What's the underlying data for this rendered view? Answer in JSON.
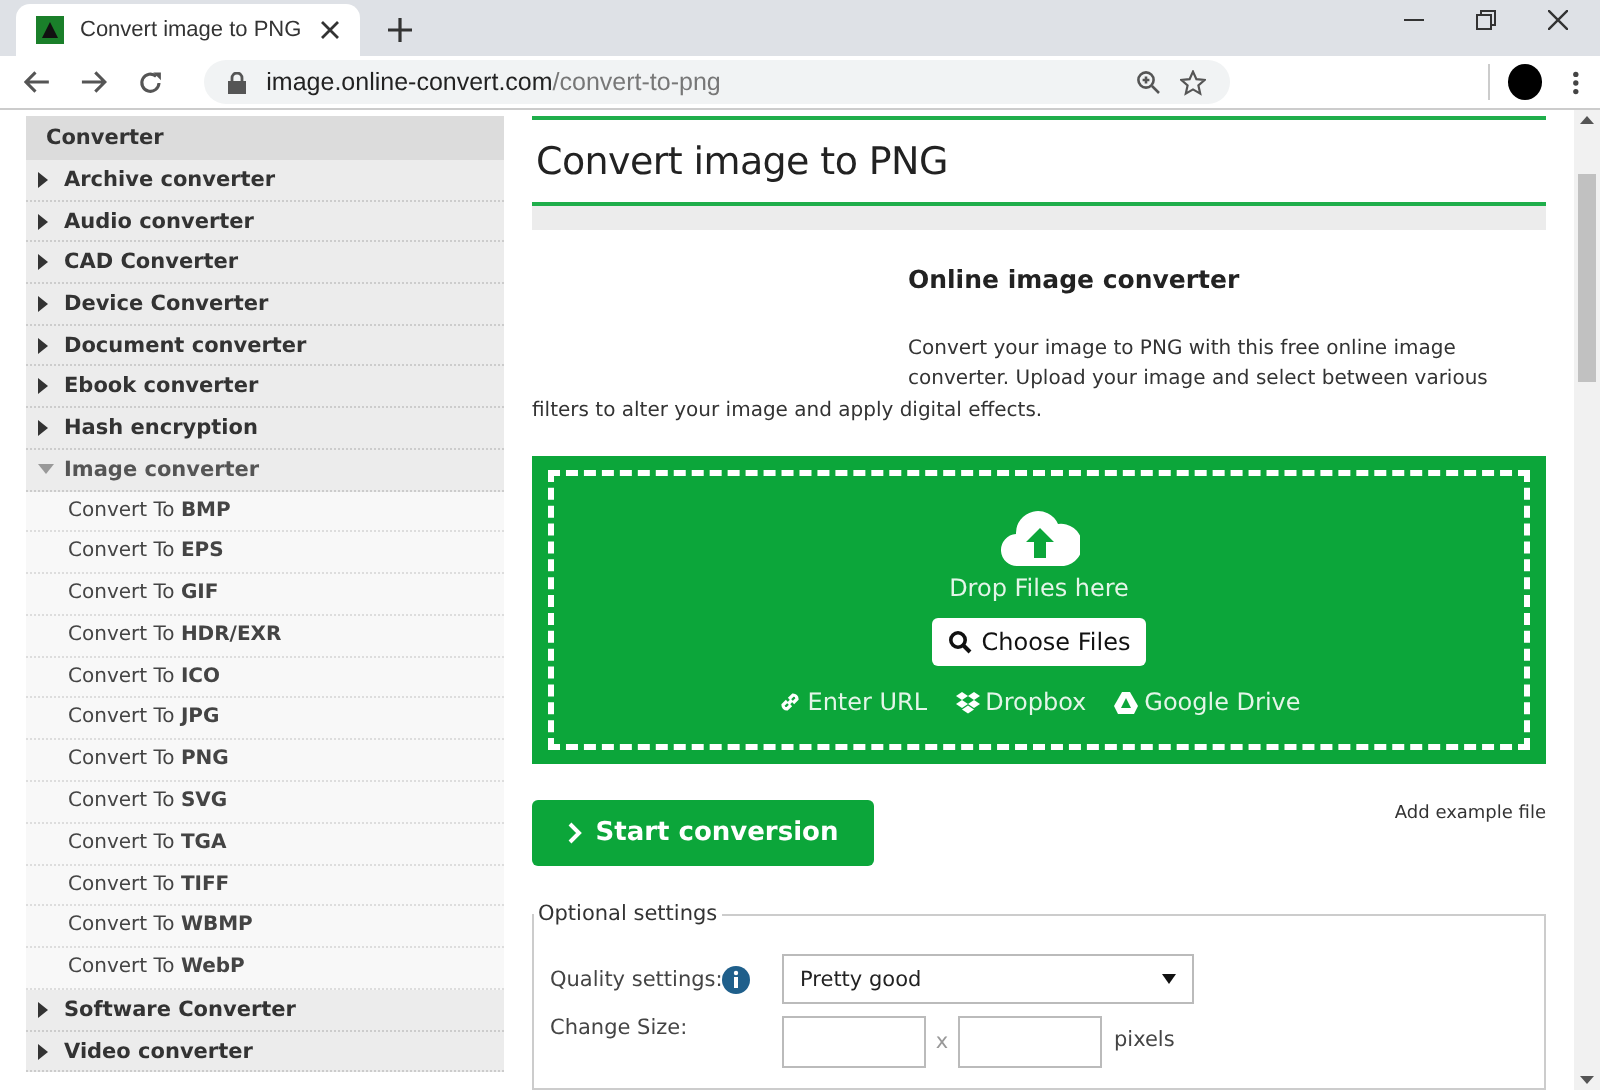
{
  "browser": {
    "tab_title": "Convert image to PNG",
    "url_host": "image.online-convert.com",
    "url_path": "/convert-to-png"
  },
  "sidebar": {
    "title": "Converter",
    "items": [
      {
        "label": "Archive converter",
        "expanded": false
      },
      {
        "label": "Audio converter",
        "expanded": false
      },
      {
        "label": "CAD Converter",
        "expanded": false
      },
      {
        "label": "Device Converter",
        "expanded": false
      },
      {
        "label": "Document converter",
        "expanded": false
      },
      {
        "label": "Ebook converter",
        "expanded": false
      },
      {
        "label": "Hash encryption",
        "expanded": false
      },
      {
        "label": "Image converter",
        "expanded": true,
        "children": [
          {
            "label": "Convert To **BMP**"
          },
          {
            "label": "Convert To **EPS**"
          },
          {
            "label": "Convert To **GIF**"
          },
          {
            "label": "Convert To **HDR/EXR**"
          },
          {
            "label": "Convert To **ICO**"
          },
          {
            "label": "Convert To **JPG**"
          },
          {
            "label": "Convert To **PNG**"
          },
          {
            "label": "Convert To **SVG**"
          },
          {
            "label": "Convert To **TGA**"
          },
          {
            "label": "Convert To **TIFF**"
          },
          {
            "label": "Convert To **WBMP**"
          },
          {
            "label": "Convert To **WebP**"
          }
        ]
      },
      {
        "label": "Software Converter",
        "expanded": false
      },
      {
        "label": "Video converter",
        "expanded": false
      }
    ]
  },
  "main": {
    "title": "Convert image to PNG",
    "intro_heading": "Online image converter",
    "intro_text": "Convert your image to PNG with this free online image converter. Upload your image and select between various filters to alter your image and apply digital effects.",
    "dropzone": {
      "hint": "Drop Files here",
      "choose_button": "Choose Files",
      "sources": [
        "Enter URL",
        "Dropbox",
        "Google Drive"
      ]
    },
    "start_button": "Start conversion",
    "example_link": "Add example file",
    "settings": {
      "legend": "Optional settings",
      "quality_label": "Quality settings:",
      "quality_value": "Pretty good",
      "size_label": "Change Size:",
      "size_separator": "x",
      "size_unit": "pixels"
    }
  }
}
